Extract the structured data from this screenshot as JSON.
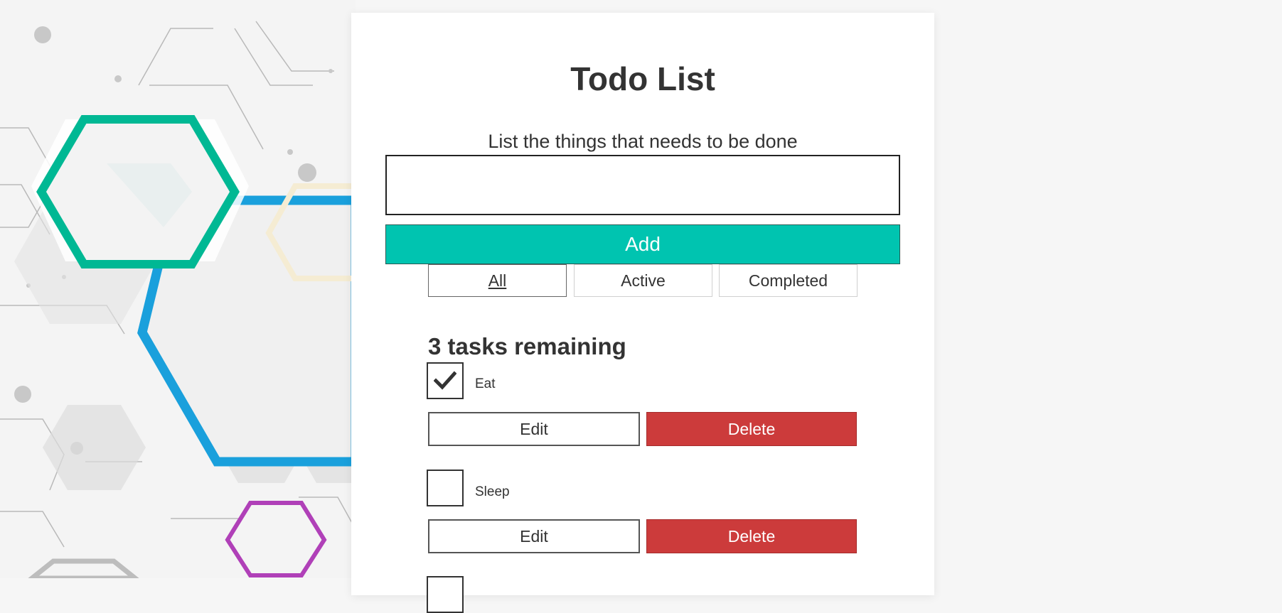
{
  "app": {
    "title": "Todo List",
    "subtitle": "List the things that needs to be done"
  },
  "input": {
    "value": "",
    "placeholder": ""
  },
  "add_label": "Add",
  "filters": [
    {
      "label": "All",
      "selected": true
    },
    {
      "label": "Active",
      "selected": false
    },
    {
      "label": "Completed",
      "selected": false
    }
  ],
  "remaining_text": "3 tasks remaining",
  "tasks": [
    {
      "name": "Eat",
      "checked": true,
      "edit_label": "Edit",
      "delete_label": "Delete"
    },
    {
      "name": "Sleep",
      "checked": false,
      "edit_label": "Edit",
      "delete_label": "Delete"
    },
    {
      "name": "",
      "checked": false
    }
  ],
  "colors": {
    "accent": "#00c4b0",
    "danger": "#cc3b3b",
    "text": "#333333",
    "background": "#ffffff"
  },
  "icons": {
    "check": "checkmark-icon",
    "background": "hexagon-background-art"
  }
}
